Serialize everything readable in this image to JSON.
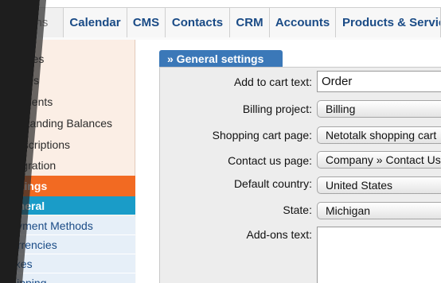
{
  "nav": {
    "tabs": [
      {
        "label": "Options"
      },
      {
        "label": "Calendar"
      },
      {
        "label": "CMS"
      },
      {
        "label": "Contacts"
      },
      {
        "label": "CRM"
      },
      {
        "label": "Accounts"
      },
      {
        "label": "Products & Services"
      }
    ]
  },
  "sidebar": {
    "items": [
      {
        "label": "Invoices"
      },
      {
        "label": "Quotes"
      },
      {
        "label": "Payments"
      },
      {
        "label": "Outstanding Balances"
      },
      {
        "label": "Subscriptions"
      },
      {
        "label": "Integration"
      },
      {
        "label": "Settings"
      }
    ],
    "subitems": [
      {
        "label": "General"
      },
      {
        "label": "Payment Methods"
      },
      {
        "label": "Currencies"
      },
      {
        "label": "Taxes"
      },
      {
        "label": "Shipping"
      }
    ]
  },
  "panel": {
    "title": "» General settings",
    "fields": {
      "add_to_cart_text": {
        "label": "Add to cart text:",
        "value": "Order"
      },
      "billing_project": {
        "label": "Billing project:",
        "value": "Billing"
      },
      "shopping_cart_page": {
        "label": "Shopping cart page:",
        "value": "Netotalk shopping cart"
      },
      "contact_us_page": {
        "label": "Contact us page:",
        "value": "Company » Contact Us"
      },
      "default_country": {
        "label": "Default country:",
        "value": "United States"
      },
      "state": {
        "label": "State:",
        "value": "Michigan"
      },
      "addons_text": {
        "label": "Add-ons text:",
        "value": ""
      }
    }
  },
  "colors": {
    "accent": "#f26a22",
    "link": "#1a4b86",
    "panel_header": "#3b78b8",
    "active_sub": "#1a9cc8"
  }
}
